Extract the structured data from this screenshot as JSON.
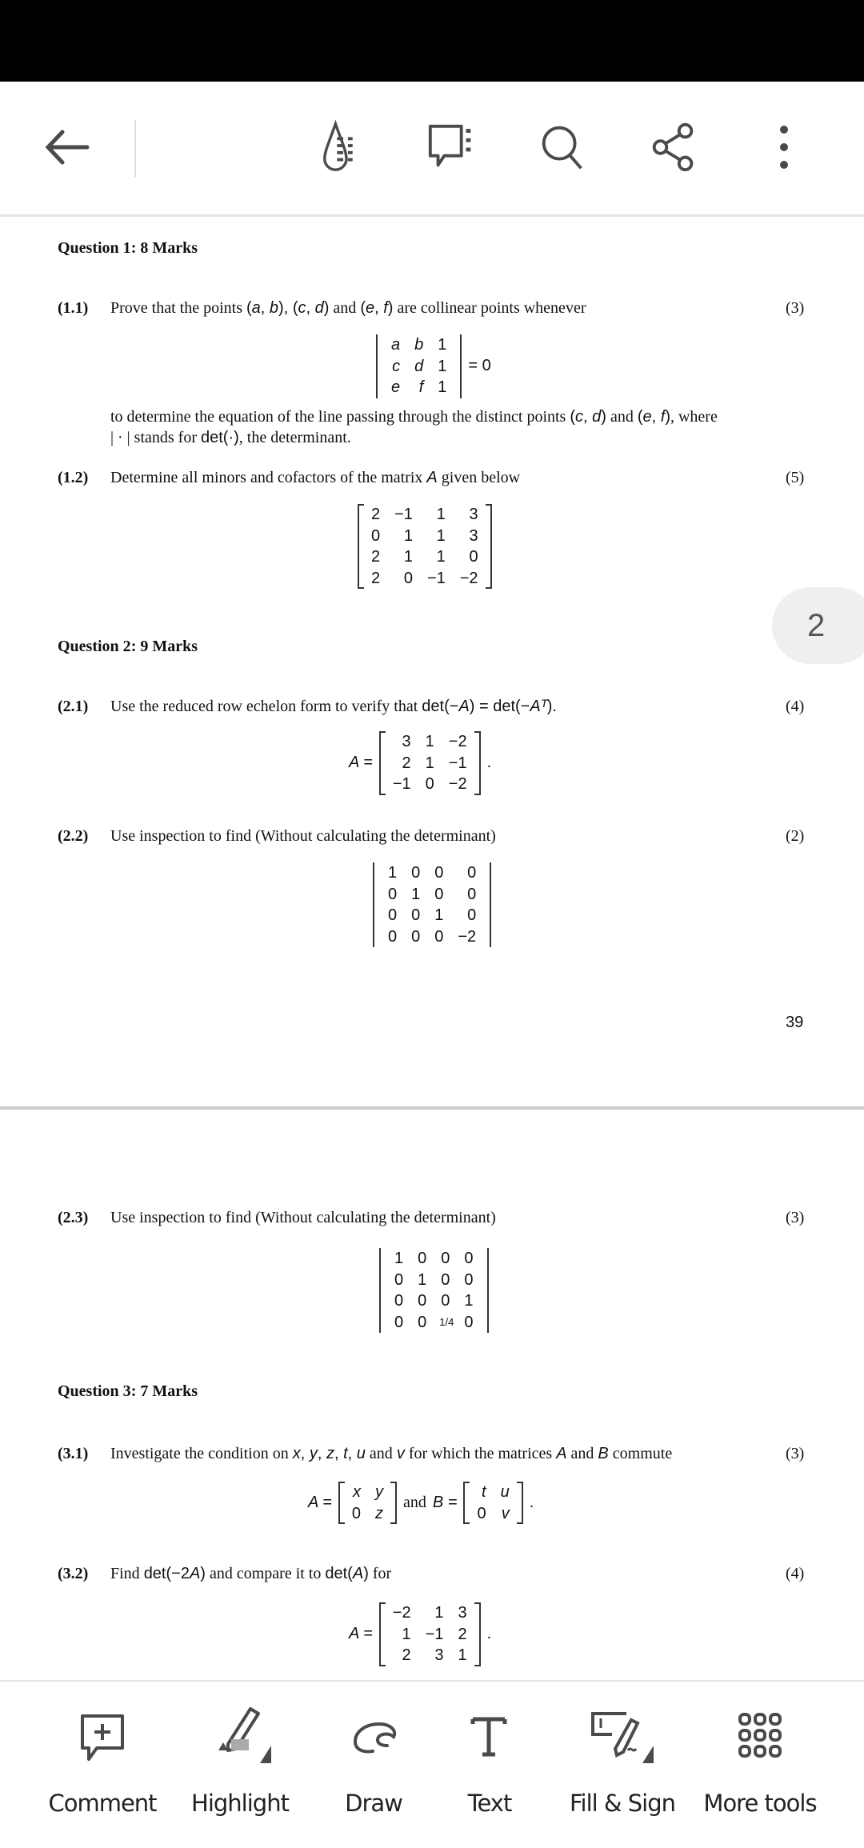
{
  "toolbar": {
    "icons": [
      "back-arrow-icon",
      "reading-mode-icon",
      "comments-list-icon",
      "search-icon",
      "share-icon",
      "more-options-icon"
    ]
  },
  "page_badge": "2",
  "page_number": "39",
  "questions": [
    {
      "heading": [
        [
          "Question 1",
          "b"
        ],
        [
          ": 8 Marks",
          "b"
        ]
      ]
    },
    {
      "heading": [
        [
          "Question 2",
          "b"
        ],
        [
          ": 9 Marks",
          "b"
        ]
      ]
    },
    {
      "heading": [
        [
          "Question 3",
          "b"
        ],
        [
          ": 7 Marks",
          "b"
        ]
      ]
    }
  ],
  "items": {
    "q11": {
      "label": "(1.1)",
      "marks": "(3)",
      "text": [
        [
          "Prove that the points ",
          "t"
        ],
        [
          "(",
          "n"
        ],
        [
          "a",
          "m"
        ],
        [
          ", ",
          "n"
        ],
        [
          "b",
          "m"
        ],
        [
          ")",
          "n"
        ],
        [
          ", ",
          "n"
        ],
        [
          "(",
          "n"
        ],
        [
          "c",
          "m"
        ],
        [
          ", ",
          "n"
        ],
        [
          "d",
          "m"
        ],
        [
          ")",
          "n"
        ],
        [
          " and ",
          "t"
        ],
        [
          "(",
          "n"
        ],
        [
          "e",
          "m"
        ],
        [
          ", ",
          "n"
        ],
        [
          "f",
          "m"
        ],
        [
          ")",
          "n"
        ],
        [
          " are collinear points whenever",
          "t"
        ]
      ],
      "eq": [
        {
          "matrix": {
            "style": "det",
            "rows": [
              [
                "a",
                "b",
                "1"
              ],
              [
                "c",
                "d",
                "1"
              ],
              [
                "e",
                "f",
                "1"
              ]
            ],
            "italic_cols": [
              0,
              1
            ]
          }
        },
        {
          "text": "= 0",
          "cls": "n"
        }
      ],
      "text2": [
        [
          "to determine the equation of the line passing through the distinct points ",
          "t"
        ],
        [
          "(",
          "n"
        ],
        [
          "c",
          "m"
        ],
        [
          ", ",
          "n"
        ],
        [
          "d",
          "m"
        ],
        [
          ")",
          "n"
        ],
        [
          " and ",
          "t"
        ],
        [
          "(",
          "n"
        ],
        [
          "e",
          "m"
        ],
        [
          ", ",
          "n"
        ],
        [
          "f",
          "m"
        ],
        [
          ")",
          "n"
        ],
        [
          ", where",
          "t"
        ]
      ],
      "text3": [
        [
          "| · | stands for ",
          "t"
        ],
        [
          "det(·)",
          "n"
        ],
        [
          ", the determinant.",
          "t"
        ]
      ]
    },
    "q12": {
      "label": "(1.2)",
      "marks": "(5)",
      "text": [
        [
          "Determine all minors and cofactors of the matrix ",
          "t"
        ],
        [
          "A",
          "m"
        ],
        [
          " given below",
          "t"
        ]
      ],
      "eq": [
        {
          "matrix": {
            "style": "brk",
            "rows": [
              [
                "2",
                "−1",
                "1",
                "3"
              ],
              [
                "0",
                "1",
                "1",
                "3"
              ],
              [
                "2",
                "1",
                "1",
                "0"
              ],
              [
                "2",
                "0",
                "−1",
                "−2"
              ]
            ]
          }
        }
      ]
    },
    "q21": {
      "label": "(2.1)",
      "marks": "(4)",
      "text": [
        [
          "Use the reduced row echelon form to verify that ",
          "t"
        ],
        [
          "det(−",
          "n"
        ],
        [
          "A",
          "m"
        ],
        [
          ") = det(−",
          "n"
        ],
        [
          "A",
          "m"
        ],
        [
          "ᵀ",
          "m"
        ],
        [
          ").",
          "n"
        ]
      ],
      "eq": [
        {
          "text": "A =",
          "cls": "m"
        },
        {
          "matrix": {
            "style": "brk",
            "rows": [
              [
                "3",
                "1",
                "−2"
              ],
              [
                "2",
                "1",
                "−1"
              ],
              [
                "−1",
                "0",
                "−2"
              ]
            ]
          }
        },
        {
          "text": ".",
          "cls": "n"
        }
      ]
    },
    "q22": {
      "label": "(2.2)",
      "marks": "(2)",
      "text": [
        [
          "Use inspection to find (Without calculating the determinant)",
          "t"
        ]
      ],
      "eq": [
        {
          "matrix": {
            "style": "det",
            "rows": [
              [
                "1",
                "0",
                "0",
                "0"
              ],
              [
                "0",
                "1",
                "0",
                "0"
              ],
              [
                "0",
                "0",
                "1",
                "0"
              ],
              [
                "0",
                "0",
                "0",
                "−2"
              ]
            ]
          }
        }
      ]
    },
    "q23": {
      "label": "(2.3)",
      "marks": "(3)",
      "text": [
        [
          "Use inspection to find (Without calculating the determinant)",
          "t"
        ]
      ],
      "eq": [
        {
          "matrix": {
            "style": "det",
            "rows": [
              [
                "1",
                "0",
                "0",
                "0"
              ],
              [
                "0",
                "1",
                "0",
                "0"
              ],
              [
                "0",
                "0",
                "0",
                "1"
              ],
              [
                "0",
                "0",
                "1/4",
                "0"
              ]
            ]
          }
        }
      ]
    },
    "q31": {
      "label": "(3.1)",
      "marks": "(3)",
      "text": [
        [
          "Investigate the condition on ",
          "t"
        ],
        [
          "x",
          "m"
        ],
        [
          ", ",
          "n"
        ],
        [
          "y",
          "m"
        ],
        [
          ", ",
          "n"
        ],
        [
          "z",
          "m"
        ],
        [
          ", ",
          "n"
        ],
        [
          "t",
          "m"
        ],
        [
          ", ",
          "n"
        ],
        [
          "u",
          "m"
        ],
        [
          " and ",
          "t"
        ],
        [
          "v",
          "m"
        ],
        [
          " for which the matrices ",
          "t"
        ],
        [
          "A",
          "m"
        ],
        [
          " and ",
          "t"
        ],
        [
          "B",
          "m"
        ],
        [
          " commute",
          "t"
        ]
      ],
      "eq": [
        {
          "text": "A =",
          "cls": "m"
        },
        {
          "matrix": {
            "style": "brk",
            "rows": [
              [
                "x",
                "y"
              ],
              [
                "0",
                "z"
              ]
            ],
            "italic_cols": [
              0,
              1
            ]
          }
        },
        {
          "text": "and",
          "cls": "t"
        },
        {
          "text": "B =",
          "cls": "m"
        },
        {
          "matrix": {
            "style": "brk",
            "rows": [
              [
                "t",
                "u"
              ],
              [
                "0",
                "v"
              ]
            ],
            "italic_cols": [
              0,
              1
            ]
          }
        },
        {
          "text": ".",
          "cls": "n"
        }
      ]
    },
    "q32": {
      "label": "(3.2)",
      "marks": "(4)",
      "text": [
        [
          "Find ",
          "t"
        ],
        [
          "det(−2",
          "n"
        ],
        [
          "A",
          "m"
        ],
        [
          ")",
          "n"
        ],
        [
          " and compare it to ",
          "t"
        ],
        [
          "det(",
          "n"
        ],
        [
          "A",
          "m"
        ],
        [
          ")",
          "n"
        ],
        [
          " for",
          "t"
        ]
      ],
      "eq": [
        {
          "text": "A =",
          "cls": "m"
        },
        {
          "matrix": {
            "style": "brk",
            "rows": [
              [
                "−2",
                "1",
                "3"
              ],
              [
                "1",
                "−1",
                "2"
              ],
              [
                "2",
                "3",
                "1"
              ]
            ]
          }
        },
        {
          "text": ".",
          "cls": "n"
        }
      ]
    }
  },
  "bottom_tools": [
    {
      "label": "Comment",
      "icon": "comment-add-icon"
    },
    {
      "label": "Highlight",
      "icon": "highlighter-icon"
    },
    {
      "label": "Draw",
      "icon": "draw-icon"
    },
    {
      "label": "Text",
      "icon": "text-icon"
    },
    {
      "label": "Fill & Sign",
      "icon": "fill-sign-icon"
    },
    {
      "label": "More tools",
      "icon": "more-tools-grid-icon"
    }
  ],
  "colors": {
    "icon": "#4a4a4a",
    "highlight_swatch": "#aaaaaa",
    "badge_bg": "#efefef"
  }
}
